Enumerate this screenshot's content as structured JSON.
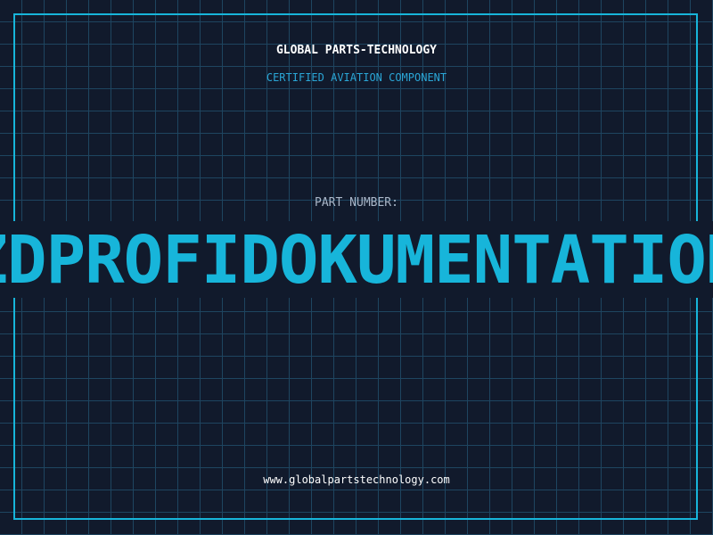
{
  "header": {
    "brand": "GLOBAL PARTS-TECHNOLOGY",
    "subtitle": "CERTIFIED AVIATION COMPONENT"
  },
  "part": {
    "label": "PART NUMBER:",
    "value": "ZDPROFIDOKUMENTATION"
  },
  "footer": {
    "url": "www.globalpartstechnology.com"
  },
  "colors": {
    "background": "#111a2c",
    "grid": "#1e4560",
    "accent": "#17b5da",
    "subtitle": "#2aa6d6",
    "label": "#a9b6c8",
    "text": "#ffffff"
  }
}
